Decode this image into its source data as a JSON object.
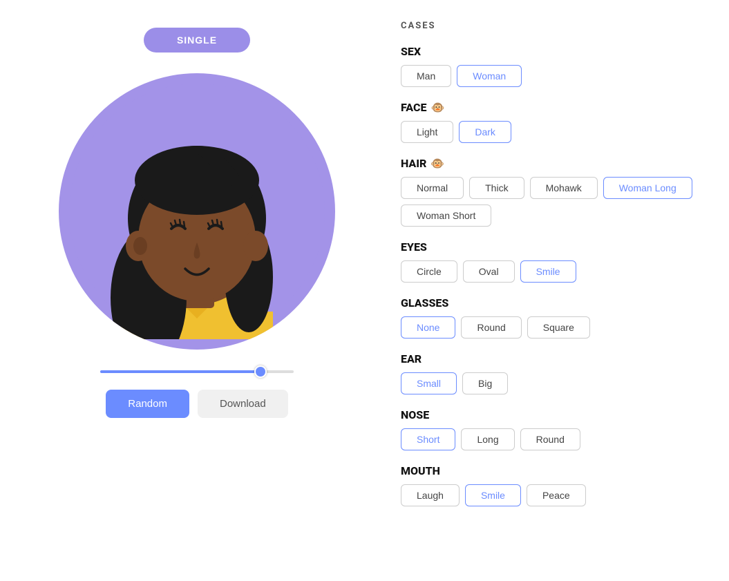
{
  "header": {
    "single_label": "SINGLE"
  },
  "cases_title": "CASES",
  "buttons": {
    "random": "Random",
    "download": "Download"
  },
  "sections": [
    {
      "id": "sex",
      "label": "SEX",
      "icon": null,
      "options": [
        {
          "label": "Man",
          "active": false
        },
        {
          "label": "Woman",
          "active": true
        }
      ]
    },
    {
      "id": "face",
      "label": "FACE",
      "icon": "🐵",
      "options": [
        {
          "label": "Light",
          "active": false
        },
        {
          "label": "Dark",
          "active": true
        }
      ]
    },
    {
      "id": "hair",
      "label": "HAIR",
      "icon": "🐵",
      "options": [
        {
          "label": "Normal",
          "active": false
        },
        {
          "label": "Thick",
          "active": false
        },
        {
          "label": "Mohawk",
          "active": false
        },
        {
          "label": "Woman Long",
          "active": true
        },
        {
          "label": "Woman Short",
          "active": false
        }
      ]
    },
    {
      "id": "eyes",
      "label": "EYES",
      "icon": null,
      "options": [
        {
          "label": "Circle",
          "active": false
        },
        {
          "label": "Oval",
          "active": false
        },
        {
          "label": "Smile",
          "active": true
        }
      ]
    },
    {
      "id": "glasses",
      "label": "GLASSES",
      "icon": null,
      "options": [
        {
          "label": "None",
          "active": true
        },
        {
          "label": "Round",
          "active": false
        },
        {
          "label": "Square",
          "active": false
        }
      ]
    },
    {
      "id": "ear",
      "label": "EAR",
      "icon": null,
      "options": [
        {
          "label": "Small",
          "active": true
        },
        {
          "label": "Big",
          "active": false
        }
      ]
    },
    {
      "id": "nose",
      "label": "NOSE",
      "icon": null,
      "options": [
        {
          "label": "Short",
          "active": true
        },
        {
          "label": "Long",
          "active": false
        },
        {
          "label": "Round",
          "active": false
        }
      ]
    },
    {
      "id": "mouth",
      "label": "MOUTH",
      "icon": null,
      "options": [
        {
          "label": "Laugh",
          "active": false
        },
        {
          "label": "Smile",
          "active": true
        },
        {
          "label": "Peace",
          "active": false
        }
      ]
    }
  ]
}
